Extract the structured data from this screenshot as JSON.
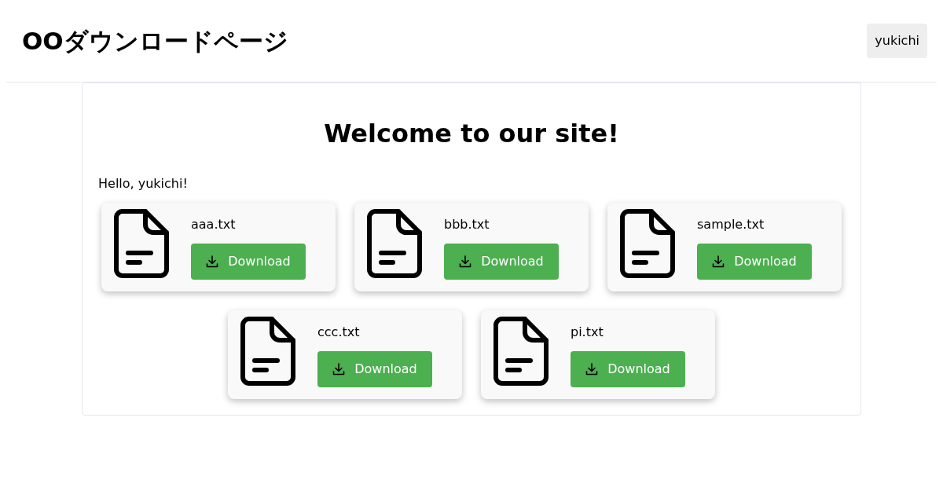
{
  "header": {
    "title": "OOダウンロードページ",
    "user_button": "yukichi"
  },
  "main": {
    "heading": "Welcome to our site!",
    "greeting": "Hello, yukichi!",
    "files": [
      {
        "name": "aaa.txt",
        "button": "Download"
      },
      {
        "name": "bbb.txt",
        "button": "Download"
      },
      {
        "name": "sample.txt",
        "button": "Download"
      },
      {
        "name": "ccc.txt",
        "button": "Download"
      },
      {
        "name": "pi.txt",
        "button": "Download"
      }
    ]
  }
}
